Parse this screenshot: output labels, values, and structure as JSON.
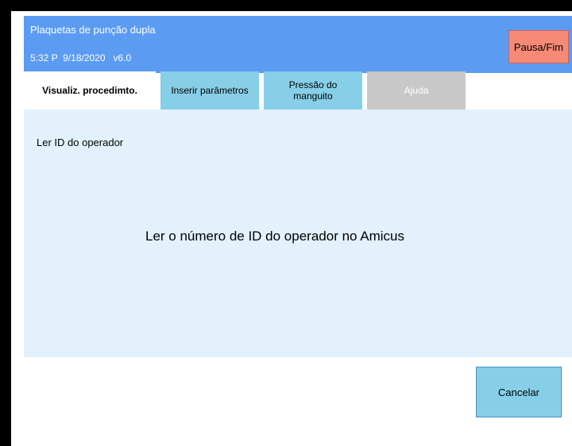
{
  "header": {
    "title": "Plaquetas de punção dupla",
    "time": "5:32 P",
    "date": "9/18/2020",
    "version": "v6.0",
    "status_line": "5:32 P  9/18/2020   v6.0",
    "pause_label": "Pausa/Fim"
  },
  "tabs": {
    "view": "Visualiz. procedimto.",
    "params": "Inserir parâmetros",
    "cuff_line1": "Pressão do",
    "cuff_line2": "manguito",
    "help": "Ajuda"
  },
  "content": {
    "instruction": "Ler ID do operador",
    "message": "Ler o número de ID do operador no Amicus"
  },
  "footer": {
    "cancel_label": "Cancelar"
  },
  "colors": {
    "header": "#5b9bf1",
    "pause": "#f78a76",
    "tab_active_bg": "#ffffff",
    "tab_bg": "#87cfe8",
    "tab_disabled": "#c8c8c8",
    "content_bg": "#e2f1fc"
  }
}
